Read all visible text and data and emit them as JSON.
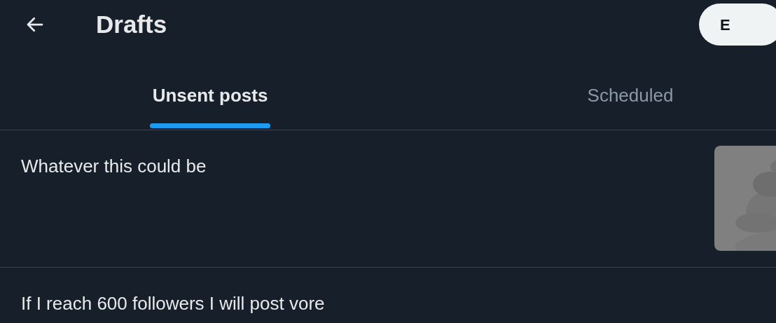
{
  "header": {
    "title": "Drafts",
    "edit_button": "E"
  },
  "tabs": [
    {
      "label": "Unsent posts",
      "selected": true
    },
    {
      "label": "Scheduled",
      "selected": false
    }
  ],
  "drafts": [
    {
      "text": "Whatever this could be"
    },
    {
      "text": "If I reach 600 followers I will post vore"
    }
  ]
}
